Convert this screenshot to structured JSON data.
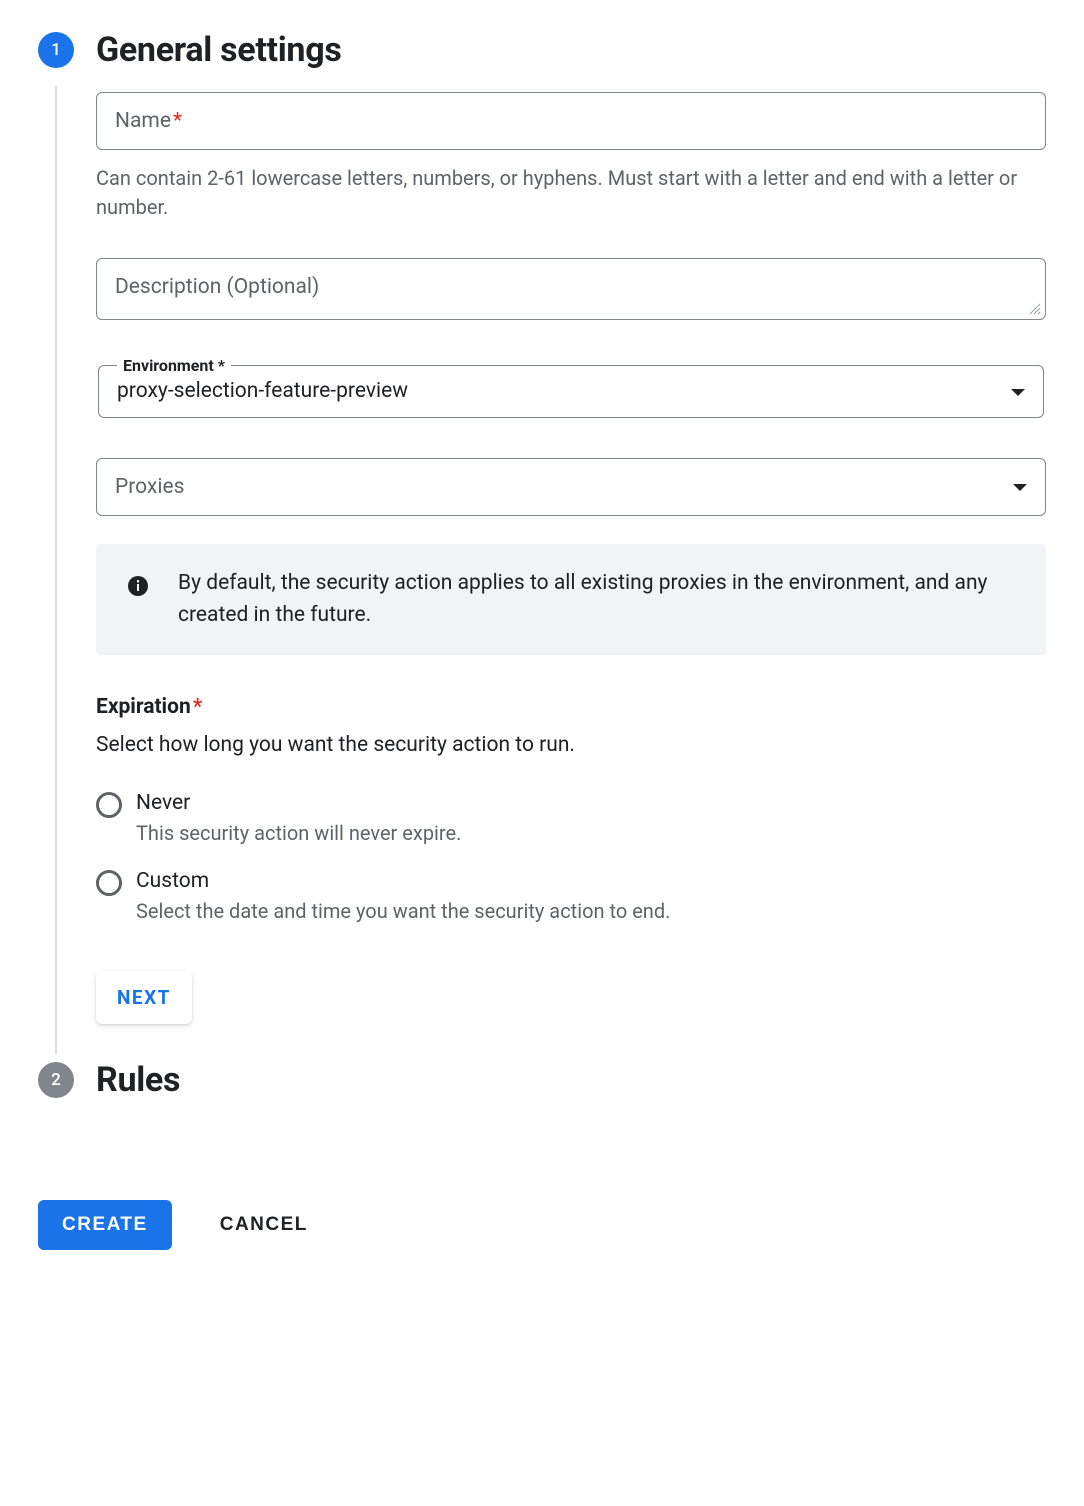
{
  "steps": {
    "one": {
      "number": "1",
      "title": "General settings"
    },
    "two": {
      "number": "2",
      "title": "Rules"
    }
  },
  "name_field": {
    "placeholder": "Name",
    "required_mark": "*",
    "helper": "Can contain 2-61 lowercase letters, numbers, or hyphens. Must start with a letter and end with a letter or number."
  },
  "description_field": {
    "placeholder": "Description (Optional)"
  },
  "environment_field": {
    "legend": "Environment *",
    "value": "proxy-selection-feature-preview"
  },
  "proxies_field": {
    "placeholder": "Proxies"
  },
  "info_box": {
    "text": "By default, the security action applies to all existing proxies in the environment, and any created in the future."
  },
  "expiration": {
    "label": "Expiration",
    "required_mark": "*",
    "desc": "Select how long you want the security action to run.",
    "options": [
      {
        "label": "Never",
        "desc": "This security action will never expire."
      },
      {
        "label": "Custom",
        "desc": "Select the date and time you want the security action to end."
      }
    ]
  },
  "buttons": {
    "next": "NEXT",
    "create": "CREATE",
    "cancel": "CANCEL"
  }
}
